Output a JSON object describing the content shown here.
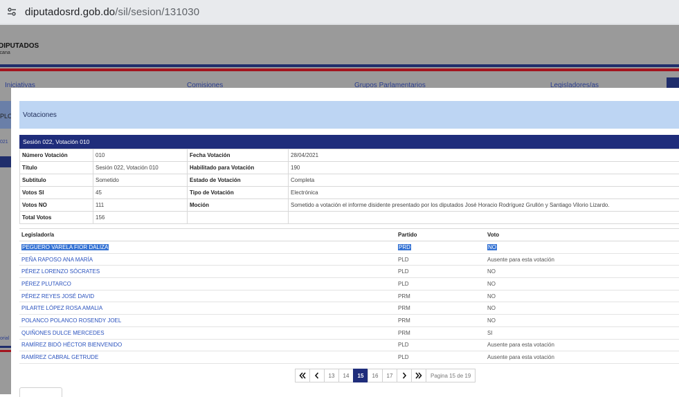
{
  "browser": {
    "url_domain": "diputadosrd.gob.do",
    "url_path": "/sil/sesion/131030"
  },
  "background": {
    "logo_title": "DIPUTADOS",
    "logo_sub": "icana",
    "nav": [
      "Iniciativas",
      "Comisiones",
      "Grupos Parlamentarios",
      "Legisladores/as"
    ],
    "left_labels": [
      "PLO",
      "021",
      "orial"
    ]
  },
  "modal": {
    "title": "Votaciones",
    "section_title": "Sesión 022, Votación 010",
    "info": [
      {
        "l1": "Número Votación",
        "v1": "010",
        "l2": "Fecha Votación",
        "v2": "28/04/2021"
      },
      {
        "l1": "Título",
        "v1": "Sesión 022, Votación 010",
        "l2": "Habilitado para Votación",
        "v2": "190"
      },
      {
        "l1": "Subtitulo",
        "v1": "Sometido",
        "l2": "Estado de Votación",
        "v2": "Completa"
      },
      {
        "l1": "Votos SI",
        "v1": "45",
        "l2": "Tipo de Votación",
        "v2": "Electrónica"
      },
      {
        "l1": "Votos NO",
        "v1": "111",
        "l2": "Moción",
        "v2": "Sometido a votación el informe disidente presentado por los diputados José Horacio Rodríguez Grullón y Santiago Vilorio Lizardo."
      },
      {
        "l1": "Total Votos",
        "v1": "156",
        "l2": "",
        "v2": ""
      }
    ],
    "columns": {
      "legislador": "Legislador/a",
      "partido": "Partido",
      "voto": "Voto"
    },
    "rows": [
      {
        "name": "PEGUERO VARELA FIOR DALIZA",
        "party": "PRD",
        "vote": "NO"
      },
      {
        "name": "PEÑA RAPOSO ANA MARÍA",
        "party": "PLD",
        "vote": "Ausente para esta votación"
      },
      {
        "name": "PÉREZ LORENZO SÓCRATES",
        "party": "PLD",
        "vote": "NO"
      },
      {
        "name": "PÉREZ PLUTARCO",
        "party": "PLD",
        "vote": "NO"
      },
      {
        "name": "PÉREZ REYES JOSÉ DAVID",
        "party": "PRM",
        "vote": "NO"
      },
      {
        "name": "PILARTE LÓPEZ ROSA AMALIA",
        "party": "PRM",
        "vote": "NO"
      },
      {
        "name": "POLANCO POLANCO ROSENDY JOEL",
        "party": "PRM",
        "vote": "NO"
      },
      {
        "name": "QUIÑONES DULCE MERCEDES",
        "party": "PRM",
        "vote": "SI"
      },
      {
        "name": "RAMÍREZ BIDÓ HÉCTOR BIENVENIDO",
        "party": "PLD",
        "vote": "Ausente para esta votación"
      },
      {
        "name": "RAMÍREZ CABRAL GETRUDE",
        "party": "PLD",
        "vote": "Ausente para esta votación"
      }
    ],
    "pagination": {
      "pages": [
        "13",
        "14",
        "15",
        "16",
        "17"
      ],
      "current": "15",
      "info": "Pagina 15 de 19"
    }
  }
}
